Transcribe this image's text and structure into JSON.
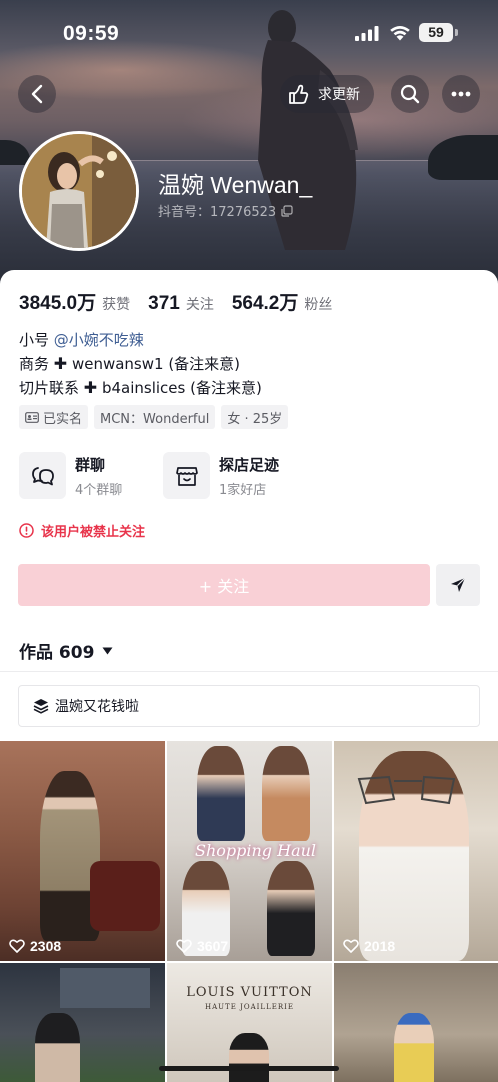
{
  "status_bar": {
    "time": "09:59",
    "battery": "59"
  },
  "top_nav": {
    "request_update_label": "求更新"
  },
  "profile": {
    "name": "温婉 Wenwan_",
    "douyin_id": "抖音号：17276523"
  },
  "stats": [
    {
      "value": "3845.0万",
      "label": "获赞"
    },
    {
      "value": "371",
      "label": "关注"
    },
    {
      "value": "564.2万",
      "label": "粉丝"
    }
  ],
  "bio": {
    "line1_prefix": "小号 ",
    "line1_mention": "@小婉不吃辣",
    "line2_prefix": "商务 ",
    "line2_text": " wenwansw1 (备注来意)",
    "line3_prefix": "切片联系 ",
    "line3_text": " b4ainslices (备注来意)"
  },
  "tags": [
    "已实名",
    "MCN：Wonderful",
    "女 · 25岁"
  ],
  "features": [
    {
      "title": "群聊",
      "subtitle": "4个群聊",
      "icon": "chat-bubbles-icon"
    },
    {
      "title": "探店足迹",
      "subtitle": "1家好店",
      "icon": "store-icon"
    }
  ],
  "warning": "该用户被禁止关注",
  "follow_button": "+ 关注",
  "works": {
    "label": "作品 609"
  },
  "collection": {
    "label": "温婉又花钱啦"
  },
  "videos": [
    {
      "likes": "2308"
    },
    {
      "likes": "3607",
      "overlay_text": "Shopping Haul"
    },
    {
      "likes": "2018"
    },
    {
      "likes": ""
    },
    {
      "likes": "",
      "overlay_text": "LOUIS VUITTON",
      "overlay_sub": "HAUTE JOAILLERIE"
    },
    {
      "likes": ""
    }
  ],
  "colors": {
    "follow_bg": "#f9d0d6",
    "warning": "#e8344b",
    "mention": "#3f5e93"
  }
}
